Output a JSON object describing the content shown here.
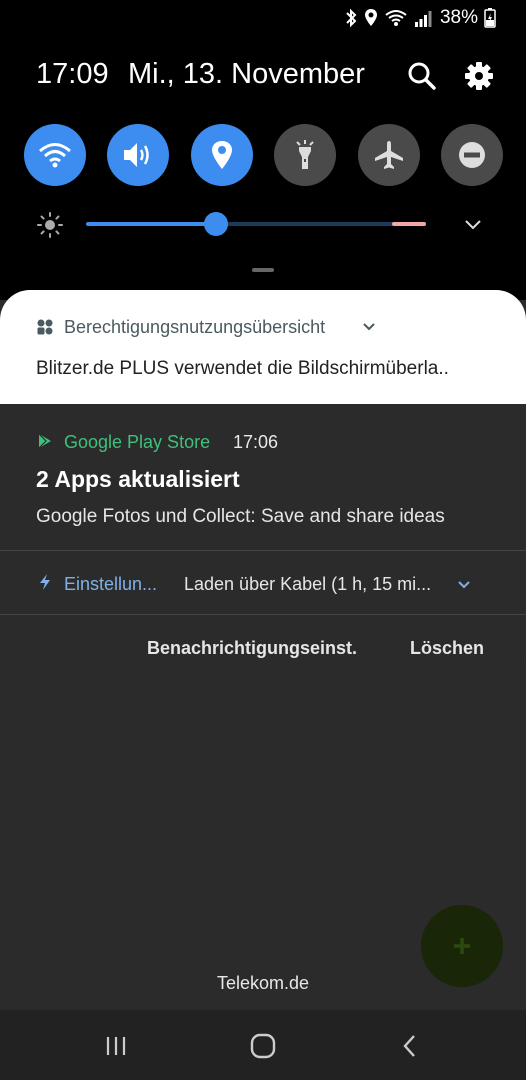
{
  "status_bar": {
    "icons": [
      "bluetooth-icon",
      "location-icon",
      "wifi-icon",
      "signal-icon",
      "battery-icon"
    ],
    "battery_percent": "38%"
  },
  "header": {
    "time": "17:09",
    "date": "Mi., 13. November",
    "search_icon": "search-icon",
    "settings_icon": "gear-icon"
  },
  "quick_settings": {
    "toggles": [
      {
        "icon": "wifi-icon",
        "state": "on"
      },
      {
        "icon": "sound-icon",
        "state": "on"
      },
      {
        "icon": "location-icon",
        "state": "on"
      },
      {
        "icon": "flashlight-icon",
        "state": "off"
      },
      {
        "icon": "airplane-icon",
        "state": "off"
      },
      {
        "icon": "do-not-disturb-icon",
        "state": "off"
      }
    ],
    "brightness_level": 0.38,
    "accent_color": "#3d8cf0"
  },
  "notifications": {
    "permissions": {
      "title": "Berechtigungsnutzungsübersicht",
      "text": "Blitzer.de PLUS verwendet die Bildschirmüberla.."
    },
    "play_store": {
      "app": "Google Play Store",
      "time": "17:06",
      "title": "2 Apps aktualisiert",
      "text": "Google Fotos und Collect: Save and share ideas",
      "app_color": "#3ec07a"
    },
    "settings": {
      "app": "Einstellun...",
      "text": "Laden über Kabel (1 h, 15 mi..."
    },
    "actions": {
      "settings_label": "Benachrichtigungseinst.",
      "clear_label": "Löschen"
    }
  },
  "footer": {
    "carrier": "Telekom.de"
  }
}
